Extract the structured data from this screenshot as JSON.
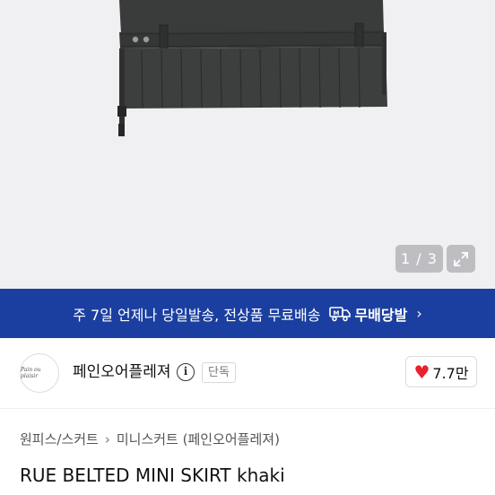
{
  "gallery": {
    "counter": "1 / 3",
    "expand_icon": "expand-arrows-icon",
    "colors": {
      "background": "#f0f0f2",
      "fabric": "#3c3e3e"
    }
  },
  "shipping_banner": {
    "text": "주 7일 언제나 당일발송, 전상품 무료배송",
    "brand": "무배당발",
    "truck_icon": "truck-icon",
    "color": "#1b3fa0"
  },
  "seller": {
    "avatar_text": "Pain ou plaisir",
    "name": "페인오어플레져",
    "info_icon": "info-icon",
    "info_symbol": "i",
    "tag": "단독",
    "likes": "7.7만",
    "like_icon": "heart-icon",
    "heart_color": "#e8212e"
  },
  "breadcrumb": {
    "items": [
      "원피스/스커트",
      "미니스커트 (페인오어플레져)"
    ],
    "separator": "›"
  },
  "product": {
    "title": "RUE BELTED MINI SKIRT khaki"
  }
}
